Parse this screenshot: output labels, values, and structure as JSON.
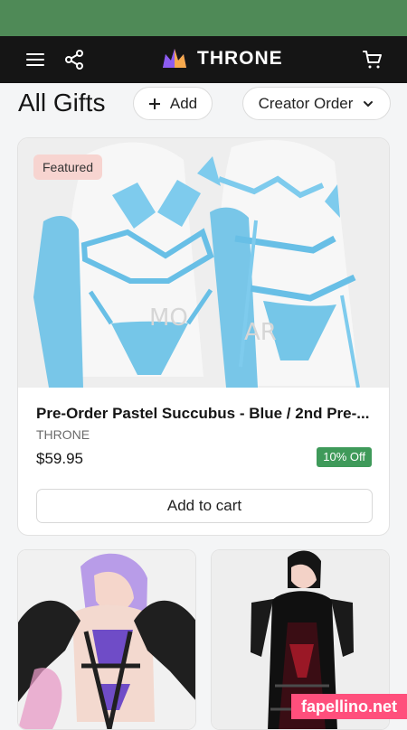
{
  "header": {
    "brand": "THRONE",
    "icons": [
      "menu-icon",
      "share-icon",
      "crown-icon",
      "cart-icon"
    ]
  },
  "toolbar": {
    "title": "All Gifts",
    "add_label": "Add",
    "sort_label": "Creator Order"
  },
  "featured": {
    "badge": "Featured",
    "title": "Pre-Order Pastel Succubus - Blue / 2nd Pre-...",
    "seller": "THRONE",
    "price": "$59.95",
    "discount": "10% Off",
    "cart_label": "Add to cart"
  },
  "watermark": "fapellino.net",
  "colors": {
    "status_bar": "#4f8a57",
    "header": "#151515",
    "discount": "#3f9a5a",
    "badge": "#f7d4d0",
    "latex_blue": "#78c6e8"
  }
}
